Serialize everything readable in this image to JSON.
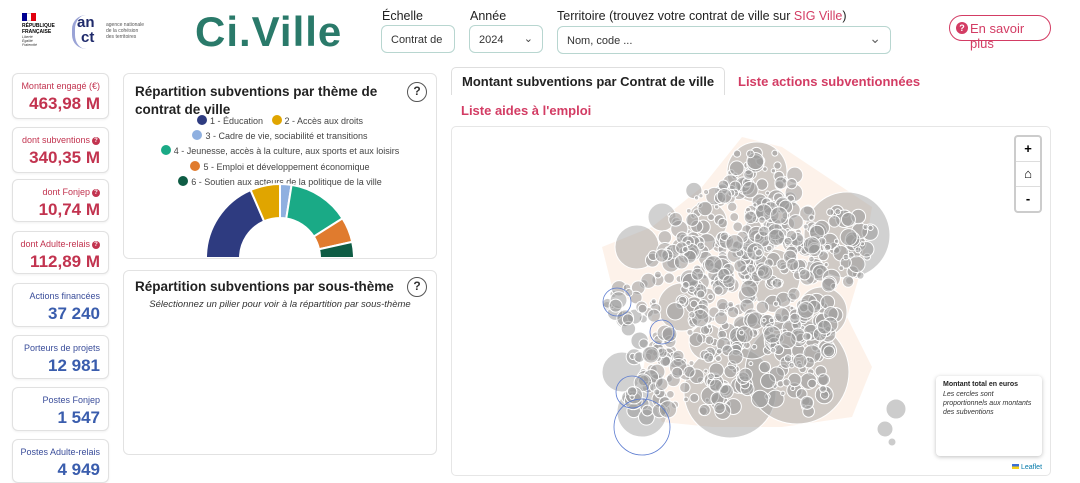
{
  "header": {
    "rf_logo": {
      "lines": [
        "RÉPUBLIQUE",
        "FRANÇAISE"
      ],
      "motto": [
        "Liberté",
        "Égalité",
        "Fraternité"
      ],
      "colors": [
        "#000091",
        "#ffffff",
        "#e1000f"
      ]
    },
    "anct_logo": {
      "mark_line1": "an",
      "mark_line2": "ct",
      "text": [
        "agence nationale",
        "de la cohésion",
        "des territoires"
      ]
    },
    "brand": "Ci.Ville",
    "filters": {
      "echelle": {
        "label": "Échelle",
        "value": "Contrat de"
      },
      "annee": {
        "label": "Année",
        "value": "2024"
      },
      "territoire": {
        "label": "Territoire (trouvez votre contrat de ville sur",
        "link": "SIG Ville",
        "label_end": ")",
        "placeholder": "Nom, code ..."
      }
    },
    "more_button": "En savoir plus"
  },
  "kpis": [
    {
      "label": "Montant engagé (€)",
      "value": "463,98 M",
      "color": "red",
      "help": false
    },
    {
      "label": "dont subventions",
      "value": "340,35 M",
      "color": "red",
      "help": true
    },
    {
      "label": "dont Fonjep",
      "value": "10,74 M",
      "color": "red",
      "help": true
    },
    {
      "label": "dont Adulte-relais",
      "value": "112,89 M",
      "color": "red",
      "help": true
    },
    {
      "label": "Actions financées",
      "value": "37 240",
      "color": "blue",
      "help": false
    },
    {
      "label": "Porteurs de projets",
      "value": "12 981",
      "color": "blue",
      "help": false
    },
    {
      "label": "Postes Fonjep",
      "value": "1 547",
      "color": "blue",
      "help": false
    },
    {
      "label": "Postes Adulte-relais",
      "value": "4 949",
      "color": "blue",
      "help": false
    }
  ],
  "theme_panel": {
    "title_line1": "Répartition subventions par thème de",
    "title_line2": "contrat de ville",
    "help": "?",
    "legend": [
      {
        "label": "1 - Éducation",
        "color": "#2e3b80"
      },
      {
        "label": "2 - Accès aux droits",
        "color": "#e0a500"
      },
      {
        "label": "3 - Cadre de vie, sociabilité et transitions",
        "color": "#8fb0e0"
      },
      {
        "label": "4 - Jeunesse, accès à la culture, aux sports et aux loisirs",
        "color": "#1aaa86"
      },
      {
        "label": "5 - Emploi et développement économique",
        "color": "#e07b2e"
      },
      {
        "label": "6 - Soutien aux acteurs de la politique de la ville",
        "color": "#0e5c44"
      }
    ]
  },
  "chart_data": {
    "type": "pie",
    "variant": "half-donut",
    "categories": [
      "1 - Éducation",
      "2 - Accès aux droits",
      "3 - Cadre de vie, sociabilité et transitions",
      "4 - Jeunesse, accès à la culture, aux sports et aux loisirs",
      "5 - Emploi et développement économique",
      "6 - Soutien aux acteurs de la politique de la ville"
    ],
    "values": [
      37,
      13,
      5,
      27,
      11,
      7
    ],
    "colors": [
      "#2e3b80",
      "#e0a500",
      "#8fb0e0",
      "#1aaa86",
      "#e07b2e",
      "#0e5c44"
    ]
  },
  "subtheme_panel": {
    "title": "Répartition subventions par sous-thème",
    "help": "?",
    "message": "Sélectionnez un pilier pour voir à la répartition par sous-thème"
  },
  "tabs": [
    {
      "label": "Montant subventions par Contrat de ville",
      "active": true
    },
    {
      "label": "Liste actions subventionnées",
      "active": false
    },
    {
      "label": "Liste aides à l'emploi",
      "active": false
    }
  ],
  "map": {
    "zoom_in": "+",
    "home_icon": "home-icon",
    "zoom_out": "-",
    "legend_title": "Montant total en euros",
    "legend_desc": "Les cercles sont proportionnels aux montants des subventions",
    "attribution": "Leaflet"
  }
}
